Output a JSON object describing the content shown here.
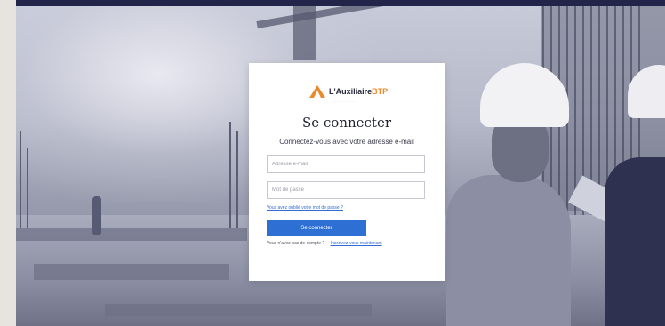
{
  "login": {
    "brand": "L'Auxiliaire",
    "brand_suffix": "BTP",
    "title": "Se connecter",
    "subtitle": "Connectez-vous avec votre adresse e-mail",
    "email_placeholder": "Adresse e-mail",
    "password_placeholder": "Mot de passe",
    "forgot_link": "Vous avez oublié votre mot de passe ?",
    "submit_label": "Se connecter",
    "signup_question": "Vous n'avez pas de compte ?",
    "signup_link": "Inscrivez-vous maintenant"
  },
  "colors": {
    "accent": "#2d6fd3",
    "brand_orange": "#e98a2b",
    "top_bar": "#22244a"
  },
  "icons": {
    "logo": "triangle-logo-icon"
  }
}
